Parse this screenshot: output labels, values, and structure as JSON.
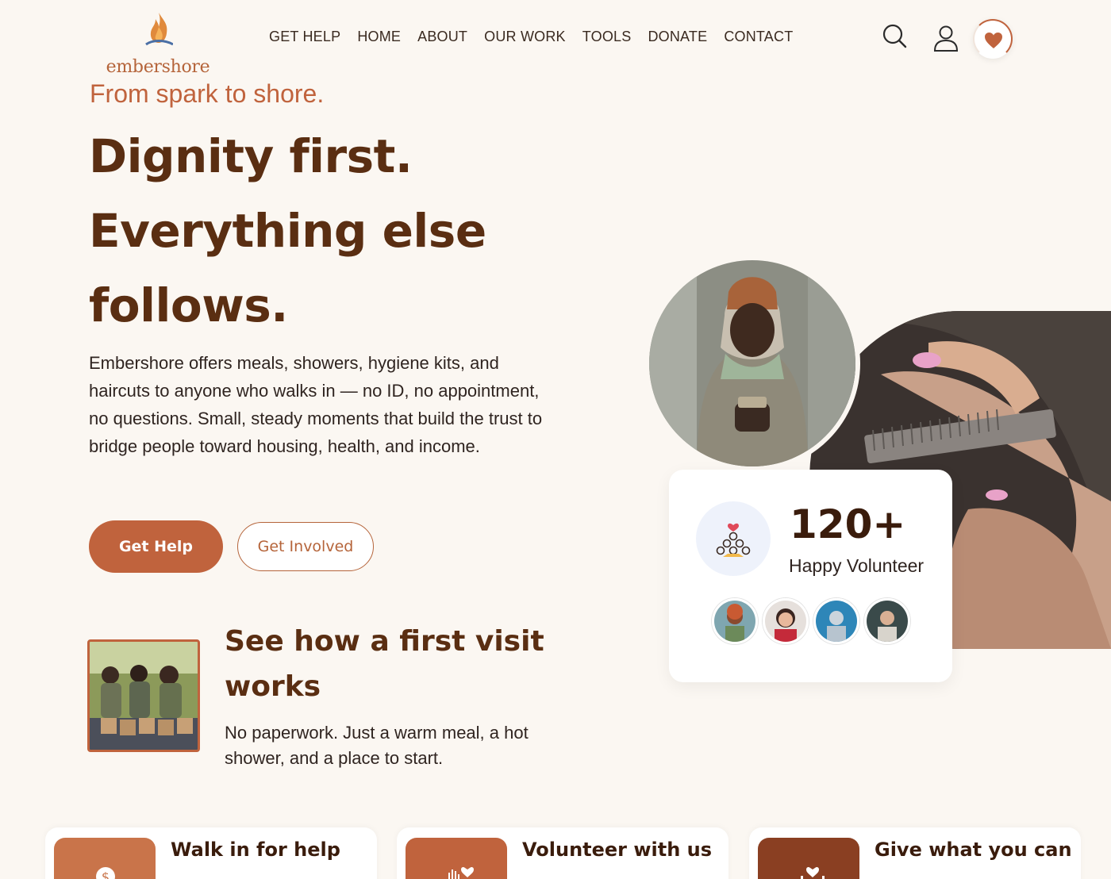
{
  "brand": {
    "name": "embershore",
    "accent": "#c0633d",
    "dark": "#5a2e12"
  },
  "nav": {
    "items": [
      "GET HELP",
      "HOME",
      "ABOUT",
      "OUR WORK",
      "TOOLS",
      "DONATE",
      "CONTACT"
    ]
  },
  "header_icons": [
    "search-icon",
    "user-icon",
    "heart-icon"
  ],
  "hero": {
    "tagline": "From spark to shore.",
    "title_line1": "Dignity first.",
    "title_line2": "Everything else",
    "title_line3": "follows.",
    "body": "Embershore offers meals, showers, hygiene kits, and haircuts to anyone who walks in — no ID, no appointment, no questions. Small, steady moments that build the trust to bridge people toward housing, health, and income.",
    "primary_button": "Get Help",
    "secondary_button": "Get Involved"
  },
  "video": {
    "title": "See how a first visit works",
    "text": "No paperwork. Just a warm meal, a hot shower, and a place to start."
  },
  "volunteers": {
    "count": "120+",
    "label": "Happy Volunteer"
  },
  "cards": [
    {
      "title": "Walk in for help",
      "icon": "dollar-icon",
      "color": "#c9744a"
    },
    {
      "title": "Volunteer with us",
      "icon": "hand-heart-icon",
      "color": "#c0633d"
    },
    {
      "title": "Give what you can",
      "icon": "heart-hands-icon",
      "color": "#8a3f22"
    }
  ]
}
